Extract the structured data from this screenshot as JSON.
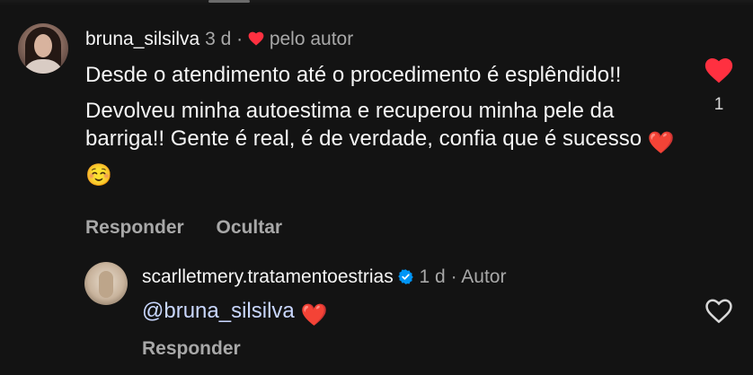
{
  "comment": {
    "username": "bruna_silsilva",
    "time": "3 d",
    "separator": "·",
    "liked_by_author": "pelo autor",
    "paragraph_1": "Desde o atendimento até o procedimento é esplêndido!!",
    "paragraph_2": "Devolveu minha autoestima e recuperou minha pele da barriga!! Gente é real, é de verdade, confia que é sucesso",
    "emoji_1": "❤️",
    "emoji_2": "☺️",
    "reply_label": "Responder",
    "hide_label": "Ocultar",
    "like_count": "1",
    "liked": true
  },
  "reply": {
    "username": "scarlletmery.tratamentoestrias",
    "verified": true,
    "time": "1 d",
    "separator": "·",
    "role": "Autor",
    "mention": "@bruna_silsilva",
    "emoji": "❤️",
    "reply_label": "Responder",
    "liked": false
  },
  "colors": {
    "background": "#131313",
    "text": "#f5f5f5",
    "muted": "#a8a8a8",
    "like_red": "#ff3040",
    "verified_blue": "#0095f6",
    "mention": "#c9d7ff"
  },
  "icons": {
    "like_filled": "heart-filled-icon",
    "like_outline": "heart-outline-icon",
    "verified": "verified-badge-icon"
  }
}
